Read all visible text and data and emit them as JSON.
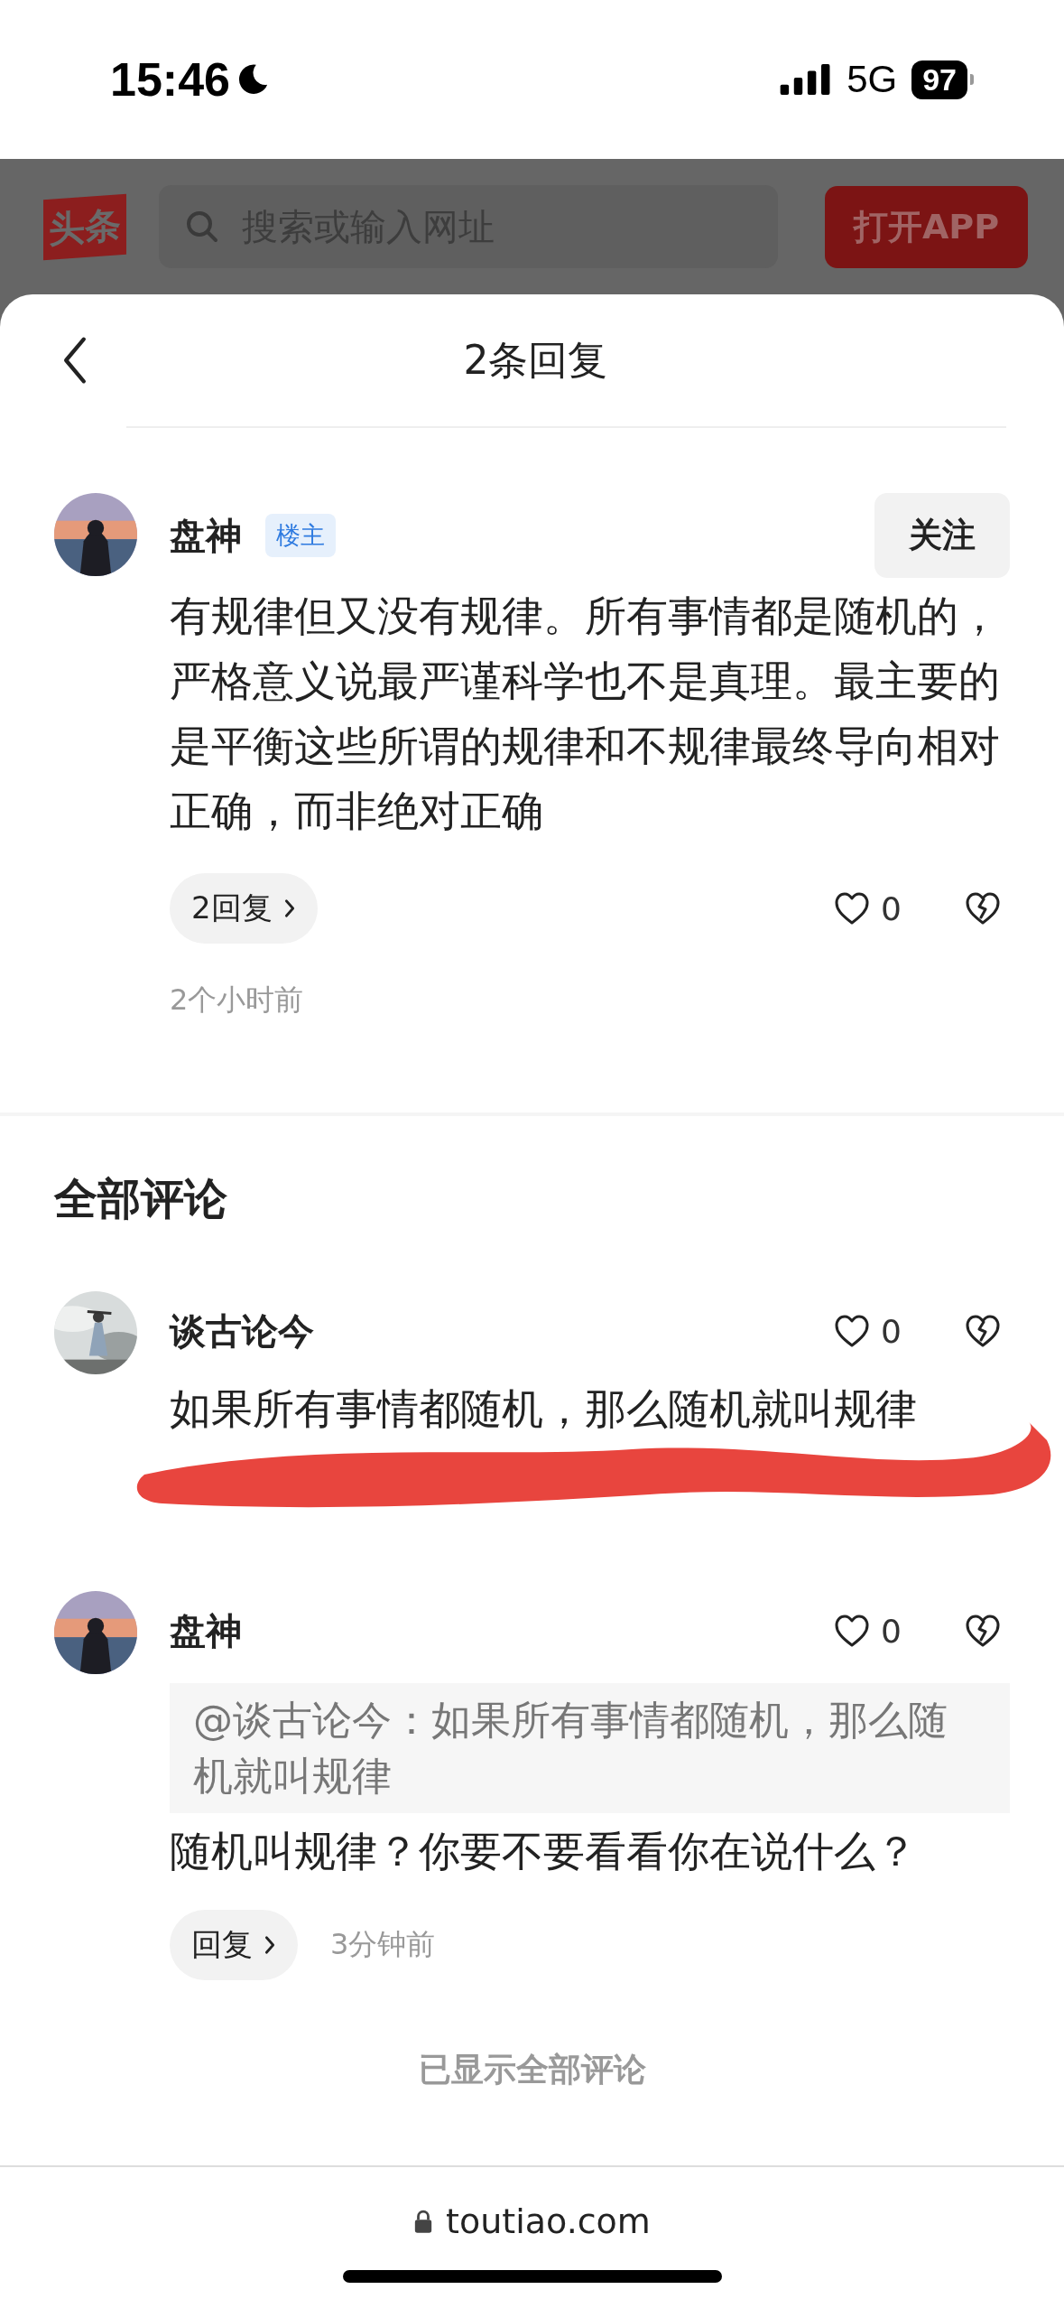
{
  "status_bar": {
    "time": "15:46",
    "network": "5G",
    "battery": "97"
  },
  "browser_header": {
    "logo": "头条",
    "search": {
      "placeholder": "搜索或输入网址"
    },
    "open_app_button": "打开APP"
  },
  "sheet": {
    "title": "2条回复"
  },
  "main_comment": {
    "author": "盘神",
    "badge": "楼主",
    "follow_button": "关注",
    "text": "有规律但又没有规律。所有事情都是随机的，严格意义说最严谨科学也不是真理。最主要的是平衡这些所谓的规律和不规律最终导向相对正确，而非绝对正确",
    "reply_button": "2回复",
    "likes": "0",
    "time": "2个小时前"
  },
  "all_comments": {
    "heading": "全部评论",
    "comments": [
      {
        "author": "谈古论今",
        "likes": "0",
        "text": "如果所有事情都随机，那么随机就叫规律",
        "scribbled": true
      },
      {
        "author": "盘神",
        "likes": "0",
        "quote": "@谈古论今：如果所有事情都随机，那么随机就叫规律",
        "text": "随机叫规律？你要不要看看你在说什么？",
        "reply_button": "回复",
        "time": "3分钟前",
        "scribbled": false
      }
    ],
    "footer": "已显示全部评论"
  },
  "address_bar": {
    "url": "toutiao.com"
  }
}
